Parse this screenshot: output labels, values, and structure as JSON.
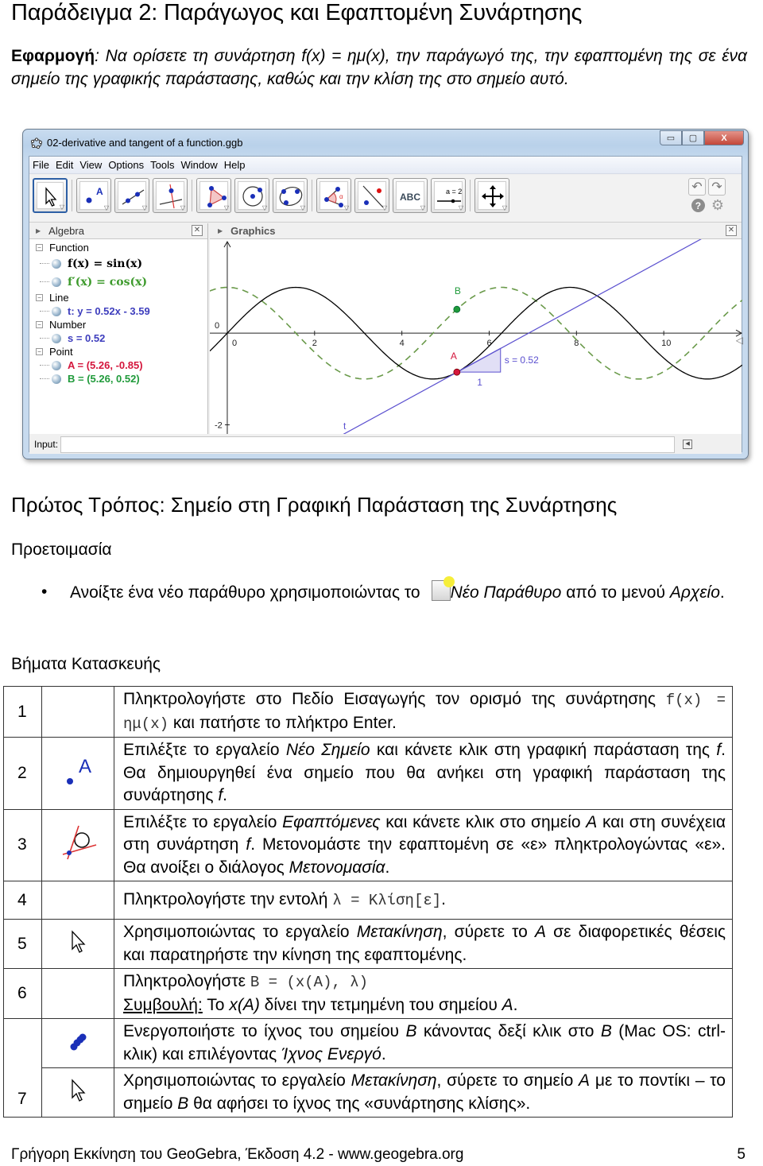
{
  "page": {
    "title": "Παράδειγμα 2: Παράγωγος και Εφαπτομένη Συνάρτησης",
    "intro_label": "Εφαρμογή",
    "intro_text": ": Να ορίσετε τη συνάρτηση f(x) = ημ(x), την παράγωγό της, την εφαπτομένη της σε ένα σημείο της γραφικής παράστασης, καθώς και την κλίση της στο σημείο αυτό."
  },
  "app": {
    "window_title": "02-derivative and tangent of a function.ggb",
    "window_controls": {
      "minimize": "▭",
      "maximize": "▢",
      "close": "X"
    },
    "menu": [
      "File",
      "Edit",
      "View",
      "Options",
      "Tools",
      "Window",
      "Help"
    ],
    "tools": [
      {
        "name": "move-tool",
        "selected": true
      },
      {
        "name": "new-point-tool"
      },
      {
        "name": "line-tool"
      },
      {
        "name": "perpendicular-line-tool"
      },
      {
        "name": "polygon-tool"
      },
      {
        "name": "circle-center-point-tool"
      },
      {
        "name": "conic-five-points-tool"
      },
      {
        "name": "angle-tool"
      },
      {
        "name": "reflect-tool"
      },
      {
        "name": "text-tool",
        "label": "ABC"
      },
      {
        "name": "slider-tool",
        "label": "a = 2"
      },
      {
        "name": "move-graphics-tool"
      }
    ],
    "algebra": {
      "title": "Algebra",
      "categories": [
        {
          "label": "Function",
          "items": [
            {
              "text": "f(x) = sin(x)",
              "color": "#000000"
            },
            {
              "text": "f′(x) = cos(x)",
              "color": "#3d9a2c"
            }
          ]
        },
        {
          "label": "Line",
          "items": [
            {
              "text": "t: y = 0.52x - 3.59",
              "color": "#3d3dbd"
            }
          ]
        },
        {
          "label": "Number",
          "items": [
            {
              "text": "s = 0.52",
              "color": "#3d3dbd"
            }
          ]
        },
        {
          "label": "Point",
          "items": [
            {
              "text": "A = (5.26, -0.85)",
              "color": "#d4163c"
            },
            {
              "text": "B = (5.26, 0.52)",
              "color": "#1f9a3a"
            }
          ]
        }
      ]
    },
    "graphics": {
      "title": "Graphics",
      "x_ticks": [
        "0",
        "2",
        "4",
        "6",
        "8",
        "10"
      ],
      "y_ticks": [
        "0",
        "-2"
      ],
      "point_A_label": "A",
      "point_B_label": "B",
      "slope_label": "s = 0.52",
      "slope_run_label": "1",
      "tangent_label": "t",
      "point_A": [
        5.26,
        -0.85
      ],
      "point_B": [
        5.26,
        0.52
      ],
      "tangent_slope": 0.52,
      "tangent_intercept": -3.59,
      "x_range": [
        -0.4,
        11.8
      ],
      "y_range": [
        -2.2,
        2.05
      ],
      "colors": {
        "sin": "#000000",
        "cos": "#6a9a4a",
        "tangent": "#5a4fcf",
        "A": "#d4163c",
        "B": "#1f9a3a"
      }
    },
    "input_label": "Input:",
    "input_value": ""
  },
  "section": {
    "heading": "Πρώτος Τρόπος: Σημείο στη Γραφική Παράσταση της Συνάρτησης",
    "prep_heading": "Προετοιμασία",
    "bullet_pre": "Ανοίξτε ένα νέο παράθυρο χρησιμοποιώντας το",
    "bullet_italic": "Νέο Παράθυρο",
    "bullet_mid": " από το μενού ",
    "bullet_italic2": "Αρχείο",
    "bullet_end": ".",
    "steps_heading": "Βήματα Κατασκευής"
  },
  "steps": [
    {
      "num": "1",
      "t1": "Πληκτρολογήστε στο Πεδίο Εισαγωγής τον ορισμό της συνάρτησης ",
      "code": "f(x) = ημ(x)",
      "t2": " και πατήστε το πλήκτρο Enter."
    },
    {
      "num": "2",
      "t1": "Επιλέξτε το εργαλείο ",
      "i1": "Νέο Σημείο",
      "t2": " και κάνετε κλικ στη γραφική παράσταση της ",
      "i2": "f",
      "t3": ". Θα δημιουργηθεί ένα σημείο που θα ανήκει στη γραφική παράσταση της συνάρτησης ",
      "i3": "f",
      "t4": "."
    },
    {
      "num": "3",
      "t1": "Επιλέξτε το εργαλείο ",
      "i1": "Εφαπτόμενες",
      "t2": " και κάνετε κλικ στο σημείο ",
      "i2": "A",
      "t3": " και στη συνέχεια στη συνάρτηση ",
      "i3": "f",
      "t4": ". Μετονομάστε την εφαπτομένη σε «ε» πληκτρολογώντας «ε». Θα ανοίξει ο διάλογος ",
      "i4": "Μετονομασία",
      "t5": "."
    },
    {
      "num": "4",
      "t1": "Πληκτρολογήστε την εντολή ",
      "code": "λ = Κλίση[ε]",
      "t2": "."
    },
    {
      "num": "5",
      "t1": "Χρησιμοποιώντας το εργαλείο ",
      "i1": "Μετακίνηση",
      "t2": ", σύρετε το ",
      "i2": "A",
      "t3": " σε διαφορετικές θέσεις και παρατηρήστε την κίνηση της εφαπτομένης."
    },
    {
      "num": "6",
      "t1": "Πληκτρολογήστε ",
      "code": "B = (x(A), λ)",
      "tip_label": "Συμβουλή:",
      "t2": " Το ",
      "i1": "x(A)",
      "t3": " δίνει την τετμημένη του σημείου ",
      "i2": "A",
      "t4": "."
    },
    {
      "num": "",
      "t1": "Ενεργοποιήστε το ίχνος του σημείου ",
      "i1": "B",
      "t2": " κάνοντας δεξί κλικ στο ",
      "i2": "B",
      "t3": " (Mac OS:  ctrl-κλικ) και επιλέγοντας ",
      "i3": "Ίχνος Ενεργό",
      "t4": "."
    },
    {
      "num": "7",
      "t1": "Χρησιμοποιώντας το εργαλείο ",
      "i1": "Μετακίνηση",
      "t2": ", σύρετε το σημείο ",
      "i2": "A",
      "t3": " με το ποντίκι – το σημείο ",
      "i3": "B",
      "t4": " θα αφήσει το ίχνος της «συνάρτησης κλίσης»."
    }
  ],
  "footer": {
    "text": "Γρήγορη Εκκίνηση του GeoGebra, Έκδοση 4.2 - www.geogebra.org",
    "page_number": "5"
  }
}
